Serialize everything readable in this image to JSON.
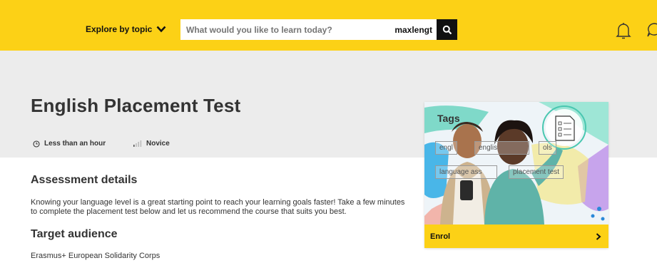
{
  "header": {
    "explore_label": "Explore by topic",
    "search_placeholder": "What would you like to learn today?",
    "search_suffix": "maxlengt"
  },
  "course": {
    "title": "English Placement Test",
    "duration": "Less than an hour",
    "level": "Novice"
  },
  "assessment": {
    "heading": "Assessment details",
    "text": "Knowing your language level is a great starting point to reach your learning goals faster! Take a few minutes to complete the placement test below and let us recommend the course that suits you best."
  },
  "audience": {
    "heading": "Target audience",
    "text": "Erasmus+ European Solidarity Corps"
  },
  "card": {
    "tags_title": "Tags",
    "tags": [
      "engl",
      "englis",
      "ols",
      "language ass",
      "placement test"
    ],
    "enrol_label": "Enrol"
  },
  "colors": {
    "accent": "#fcd116",
    "hero_bg": "#ececec",
    "dark": "#111111"
  },
  "icons": [
    "chevron-down-icon",
    "search-icon",
    "bell-icon",
    "chat-icon",
    "clock-icon",
    "level-bars-icon",
    "checklist-icon",
    "chevron-right-icon"
  ]
}
